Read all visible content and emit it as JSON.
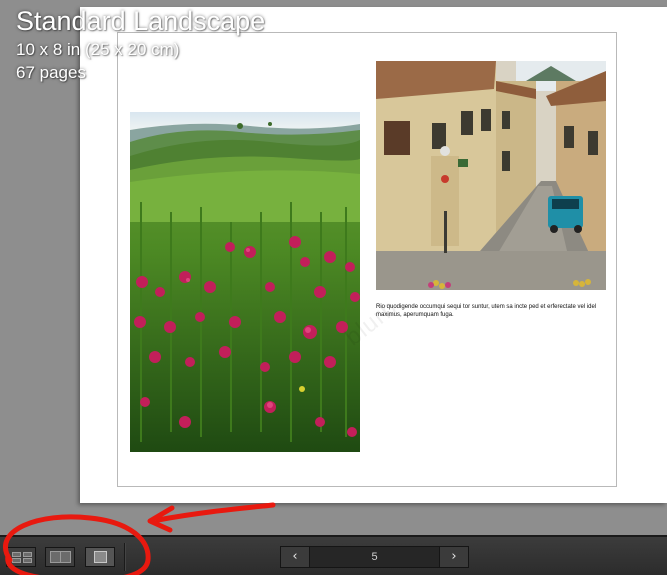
{
  "book": {
    "title": "Standard Landscape",
    "size": "10 x 8 in (25 x 20 cm)",
    "pages": "67 pages"
  },
  "spread": {
    "caption": "Rio quodigende occumqui sequi tor suntur, utem sa incte ped et erferectate vel idel maximus, aperumquam fuga.",
    "watermark": "blurb",
    "left_photo": "green hillside landscape with red wildflowers",
    "right_photo": "narrow cobblestone village street with a blue car"
  },
  "toolbar": {
    "view_buttons": [
      {
        "name": "multi-page-view",
        "icon": "grid-icon"
      },
      {
        "name": "spread-view",
        "icon": "two-page-spread-icon"
      },
      {
        "name": "single-page-view",
        "icon": "single-page-icon"
      }
    ],
    "prev_label": "‹",
    "next_label": "›",
    "current_page": "5"
  },
  "colors": {
    "canvas": "#8e8e8e",
    "toolbar": "#333333",
    "annotation": "#e8190f"
  }
}
